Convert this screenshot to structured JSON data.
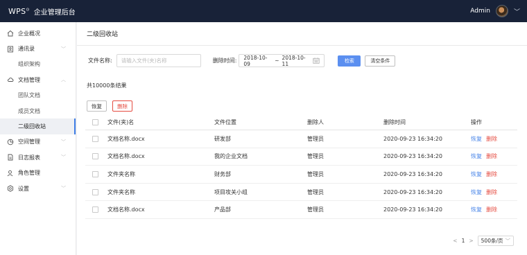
{
  "topbar": {
    "logo": "WPS",
    "app_title": "企业管理后台",
    "user_name": "Admin"
  },
  "sidebar": {
    "items": [
      {
        "label": "企业概况",
        "icon": "home-icon",
        "expandable": false
      },
      {
        "label": "通讯录",
        "icon": "contacts-icon",
        "expandable": true
      },
      {
        "label": "组织架构",
        "sub": true
      },
      {
        "label": "文档管理",
        "icon": "cloud-icon",
        "expandable": true
      },
      {
        "label": "团队文档",
        "sub": true
      },
      {
        "label": "成员文档",
        "sub": true
      },
      {
        "label": "二级回收站",
        "sub": true,
        "active": true
      },
      {
        "label": "空间管理",
        "icon": "pie-chart-icon",
        "expandable": true
      },
      {
        "label": "日志报表",
        "icon": "report-icon",
        "expandable": true
      },
      {
        "label": "角色管理",
        "icon": "user-icon",
        "expandable": false
      },
      {
        "label": "设置",
        "icon": "settings-icon",
        "expandable": true
      }
    ]
  },
  "page": {
    "title": "二级回收站"
  },
  "filters": {
    "filename_label": "文件名称:",
    "filename_placeholder": "请输入文件(夹)名称",
    "date_label": "删除时间:",
    "date_start": "2018-10-09",
    "date_sep": "~",
    "date_end": "2018-10-11",
    "search_label": "检索",
    "clear_label": "清空条件"
  },
  "result_count": "共10000条结果",
  "actions": {
    "restore_label": "恢复",
    "delete_label": "删除"
  },
  "table": {
    "headers": [
      "文件(夹)名",
      "文件位置",
      "删除人",
      "删除时间",
      "操作"
    ],
    "rows": [
      {
        "name": "文档名称.docx",
        "location": "研发部",
        "deleter": "管理员",
        "time": "2020-09-23 16:34:20"
      },
      {
        "name": "文档名称.docx",
        "location": "我的企业文档",
        "deleter": "管理员",
        "time": "2020-09-23 16:34:20"
      },
      {
        "name": "文件夹名称",
        "location": "财务部",
        "deleter": "管理员",
        "time": "2020-09-23 16:34:20"
      },
      {
        "name": "文件夹名称",
        "location": "项目攻关小组",
        "deleter": "管理员",
        "time": "2020-09-23 16:34:20"
      },
      {
        "name": "文档名称.docx",
        "location": "产品部",
        "deleter": "管理员",
        "time": "2020-09-23 16:34:20"
      }
    ],
    "op_restore": "恢复",
    "op_delete": "删除"
  },
  "pager": {
    "prev": "<",
    "current_page": "1",
    "next": ">",
    "page_size": "500条/页"
  },
  "colors": {
    "topbar": "#182238",
    "primary": "#5b8ff0",
    "danger": "#e54a3f",
    "link": "#4a86e8"
  }
}
